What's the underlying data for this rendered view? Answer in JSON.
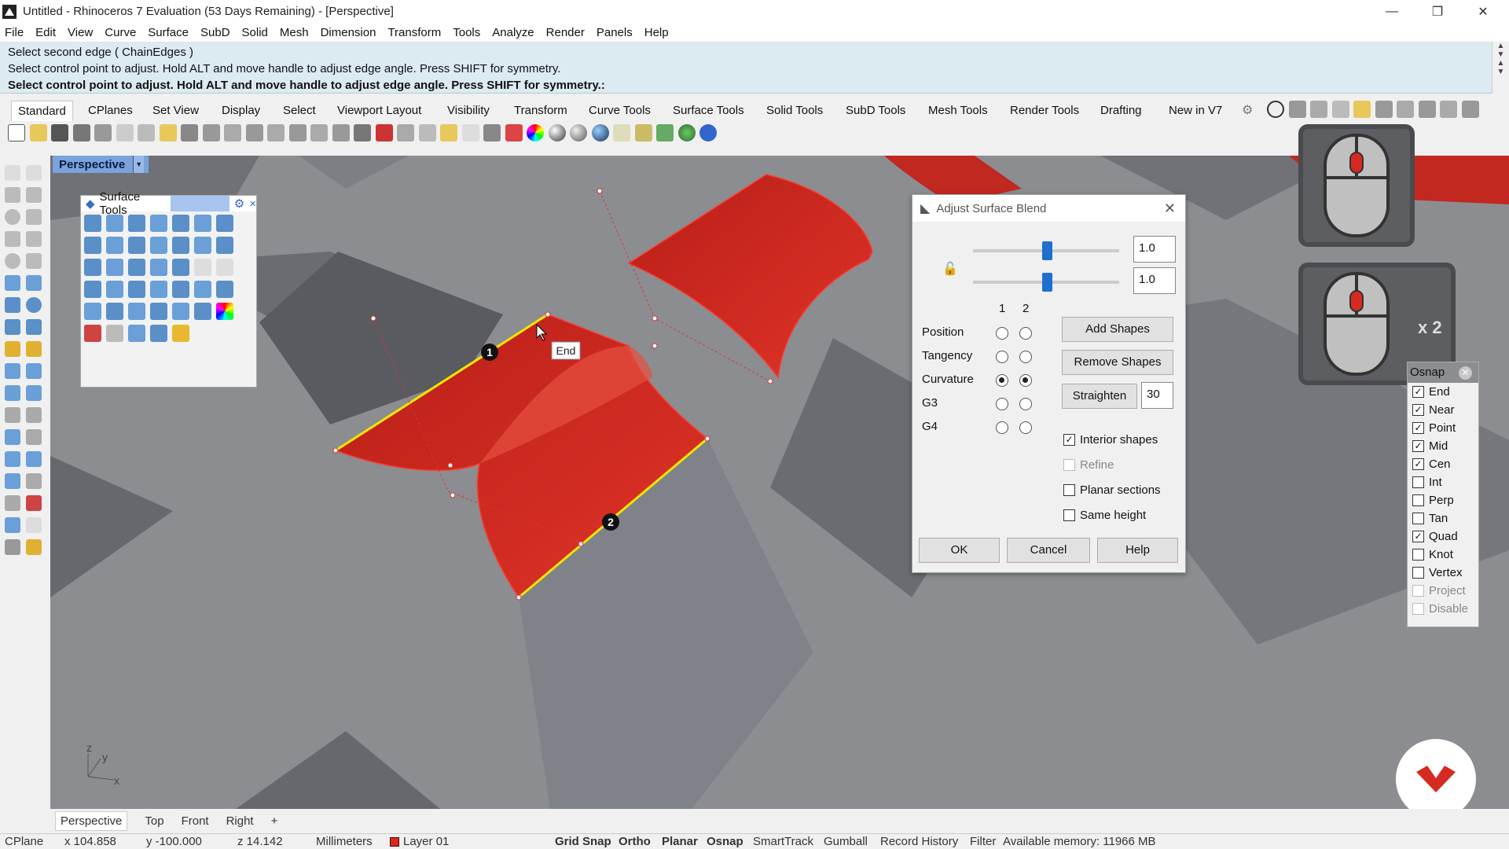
{
  "window": {
    "title": "Untitled - Rhinoceros 7 Evaluation (53 Days Remaining) - [Perspective]",
    "minimize": "—",
    "restore": "❐",
    "close": "✕"
  },
  "menu": [
    "File",
    "Edit",
    "View",
    "Curve",
    "Surface",
    "SubD",
    "Solid",
    "Mesh",
    "Dimension",
    "Transform",
    "Tools",
    "Analyze",
    "Render",
    "Panels",
    "Help"
  ],
  "command_history": [
    "Select second edge ( ChainEdges )",
    "Select control point to adjust. Hold ALT and move handle to adjust edge angle. Press SHIFT for symmetry.",
    "Select control point to adjust. Hold ALT and move handle to adjust edge angle. Press SHIFT for symmetry.:"
  ],
  "toolbar_tabs": [
    "Standard",
    "CPlanes",
    "Set View",
    "Display",
    "Select",
    "Viewport Layout",
    "Visibility",
    "Transform",
    "Curve Tools",
    "Surface Tools",
    "Solid Tools",
    "SubD Tools",
    "Mesh Tools",
    "Render Tools",
    "Drafting",
    "New in V7"
  ],
  "viewport": {
    "name": "Perspective",
    "tooltip": "End",
    "marker1": "1",
    "marker2": "2",
    "axes": {
      "x": "x",
      "y": "y",
      "z": "z"
    }
  },
  "surface_tools_panel": {
    "title": "Surface Tools",
    "gear": "⚙",
    "close": "×"
  },
  "dialog": {
    "title": "Adjust Surface Blend",
    "close": "✕",
    "value1": "1.0",
    "value2": "1.0",
    "col1": "1",
    "col2": "2",
    "rows": [
      "Position",
      "Tangency",
      "Curvature",
      "G3",
      "G4"
    ],
    "add_shapes": "Add Shapes",
    "remove_shapes": "Remove Shapes",
    "straighten": "Straighten",
    "straighten_value": "30",
    "interior_shapes": "Interior shapes",
    "refine": "Refine",
    "planar_sections": "Planar sections",
    "same_height": "Same height",
    "ok": "OK",
    "cancel": "Cancel",
    "help": "Help"
  },
  "mouse_overlay": {
    "x2": "x 2"
  },
  "osnap": {
    "title": "Osnap",
    "items": [
      {
        "label": "End",
        "checked": true,
        "disabled": false
      },
      {
        "label": "Near",
        "checked": true,
        "disabled": false
      },
      {
        "label": "Point",
        "checked": true,
        "disabled": false
      },
      {
        "label": "Mid",
        "checked": true,
        "disabled": false
      },
      {
        "label": "Cen",
        "checked": true,
        "disabled": false
      },
      {
        "label": "Int",
        "checked": false,
        "disabled": false
      },
      {
        "label": "Perp",
        "checked": false,
        "disabled": false
      },
      {
        "label": "Tan",
        "checked": false,
        "disabled": false
      },
      {
        "label": "Quad",
        "checked": true,
        "disabled": false
      },
      {
        "label": "Knot",
        "checked": false,
        "disabled": false
      },
      {
        "label": "Vertex",
        "checked": false,
        "disabled": false
      },
      {
        "label": "Project",
        "checked": false,
        "disabled": true
      },
      {
        "label": "Disable",
        "checked": false,
        "disabled": true
      }
    ]
  },
  "view_tabs": [
    "Perspective",
    "Top",
    "Front",
    "Right"
  ],
  "view_tabs_add": "+",
  "status": {
    "cplane": "CPlane",
    "x": "x 104.858",
    "y": "y -100.000",
    "z": "z 14.142",
    "units": "Millimeters",
    "layer": "Layer 01",
    "grid_snap": "Grid Snap",
    "ortho": "Ortho",
    "planar": "Planar",
    "osnap": "Osnap",
    "smarttrack": "SmartTrack",
    "gumball": "Gumball",
    "record_history": "Record History",
    "filter": "Filter",
    "memory": "Available memory: 11966 MB"
  },
  "colors": {
    "surface_red": "#d42a22",
    "edge_yellow": "#f2e600",
    "viewport_bg": "#8b8d91",
    "accent_blue": "#1f6fd0"
  }
}
